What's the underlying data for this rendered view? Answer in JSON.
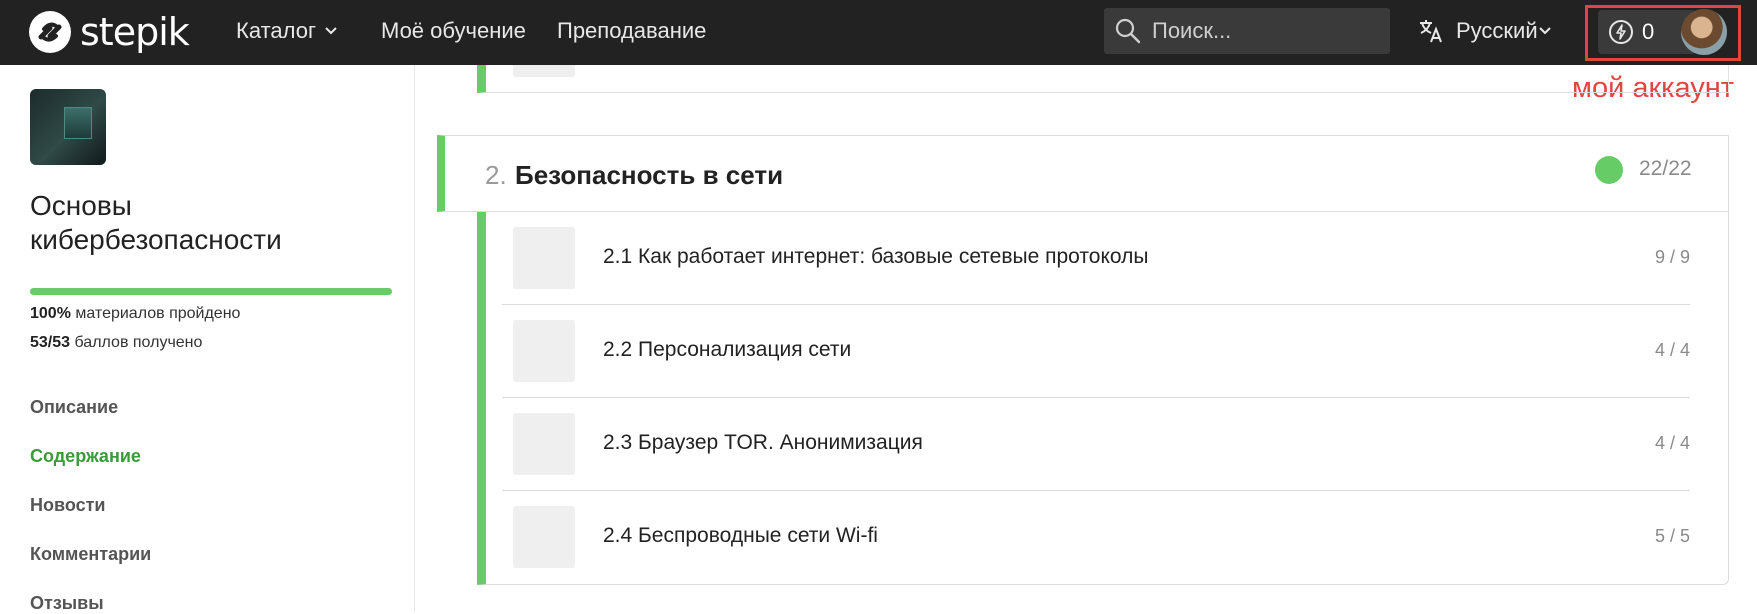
{
  "header": {
    "brand": "stepik",
    "nav": {
      "catalog": "Каталог",
      "my_learning": "Моё обучение",
      "teaching": "Преподавание"
    },
    "search": {
      "placeholder": "Поиск..."
    },
    "language": "Русский",
    "energy_count": "0",
    "annotation": "мой аккаунт",
    "accent_color": "#e0463e"
  },
  "sidebar": {
    "course_title": "Основы кибербезопасности",
    "progress_fraction": 1.0,
    "materials_value": "100%",
    "materials_text": "материалов пройдено",
    "points_value": "53/53",
    "points_text": "баллов получено",
    "links": {
      "description": "Описание",
      "content": "Содержание",
      "news": "Новости",
      "comments": "Комментарии",
      "reviews": "Отзывы"
    }
  },
  "section": {
    "number": "2.",
    "title": "Безопасность в сети",
    "score": "22/22",
    "status_color": "#66cc66"
  },
  "lessons": [
    {
      "title": "2.1 Как работает интернет: базовые сетевые протоколы",
      "score": "9 / 9"
    },
    {
      "title": "2.2 Персонализация сети",
      "score": "4 / 4"
    },
    {
      "title": "2.3 Браузер TOR. Анонимизация",
      "score": "4 / 4"
    },
    {
      "title": "2.4 Беспроводные сети Wi-fi",
      "score": "5 / 5"
    }
  ]
}
